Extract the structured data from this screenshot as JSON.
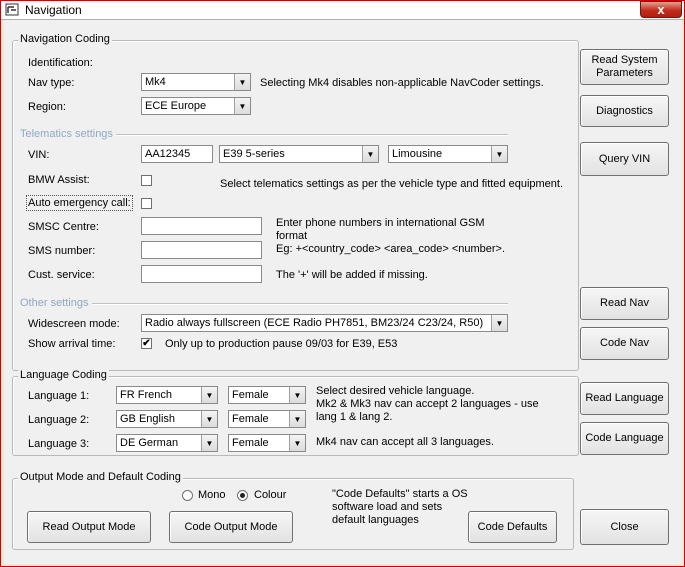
{
  "window": {
    "title": "Navigation",
    "close_symbol": "x"
  },
  "nav_coding": {
    "group_title": "Navigation Coding",
    "identification_label": "Identification:",
    "nav_type_label": "Nav type:",
    "nav_type_value": "Mk4",
    "nav_type_note": "Selecting Mk4 disables non-applicable NavCoder settings.",
    "region_label": "Region:",
    "region_value": "ECE Europe",
    "telematics_title": "Telematics settings",
    "vin_label": "VIN:",
    "vin_value": "AA12345",
    "model_value": "E39 5-series",
    "body_value": "Limousine",
    "bmw_assist_label": "BMW Assist:",
    "bmw_assist_checked": false,
    "telematics_note": "Select telematics settings as per the vehicle type and fitted equipment.",
    "auto_emergency_label": "Auto emergency call:",
    "auto_emergency_checked": false,
    "smsc_label": "SMSC Centre:",
    "smsc_value": "",
    "sms_label": "SMS number:",
    "sms_value": "",
    "cust_label": "Cust. service:",
    "cust_value": "",
    "phone_note_1": "Enter phone numbers in international GSM",
    "phone_note_2": "format",
    "phone_note_3": "Eg: +<country_code> <area_code> <number>.",
    "phone_note_4": "The '+' will be added if missing.",
    "other_title": "Other settings",
    "widescreen_label": "Widescreen mode:",
    "widescreen_value": "Radio always fullscreen (ECE Radio PH7851, BM23/24 C23/24, R50)",
    "arrival_label": "Show arrival time:",
    "arrival_checked": true,
    "arrival_note": "Only up to production pause 09/03 for E39, E53"
  },
  "side_buttons": {
    "read_system": "Read System Parameters",
    "diagnostics": "Diagnostics",
    "query_vin": "Query VIN",
    "read_nav": "Read Nav",
    "code_nav": "Code Nav",
    "read_language": "Read Language",
    "code_language": "Code Language",
    "close": "Close"
  },
  "language_coding": {
    "group_title": "Language Coding",
    "rows": [
      {
        "label": "Language 1:",
        "language": "FR French",
        "voice": "Female"
      },
      {
        "label": "Language 2:",
        "language": "GB English",
        "voice": "Female"
      },
      {
        "label": "Language 3:",
        "language": "DE German",
        "voice": "Female"
      }
    ],
    "note_1": "Select desired vehicle language.",
    "note_2": "Mk2 & Mk3 nav can accept 2 languages - use",
    "note_3": "lang 1 & lang 2.",
    "note_4": "Mk4 nav can accept all 3 languages."
  },
  "output_mode": {
    "group_title": "Output Mode and Default Coding",
    "mono_label": "Mono",
    "colour_label": "Colour",
    "selected": "Colour",
    "note_1": "\"Code Defaults\" starts a OS",
    "note_2": "software load and sets",
    "note_3": "default languages",
    "read_button": "Read Output Mode",
    "code_button": "Code Output Mode",
    "defaults_button": "Code Defaults"
  },
  "icons": {
    "dropdown": "chevron-down-icon",
    "check": "check-icon",
    "app": "app-icon",
    "close": "close-icon"
  },
  "colors": {
    "frame": "#c00000",
    "close_button": "#c42b1c",
    "subheading": "#8fa8c8",
    "face": "#f0f0f0"
  }
}
